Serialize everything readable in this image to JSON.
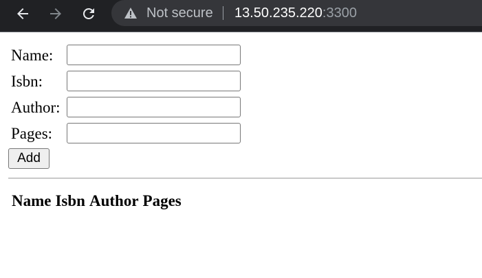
{
  "browser": {
    "security_text": "Not secure",
    "url_host": "13.50.235.220",
    "url_port": ":3300"
  },
  "form": {
    "fields": [
      {
        "label": "Name:",
        "value": ""
      },
      {
        "label": "Isbn:",
        "value": ""
      },
      {
        "label": "Author:",
        "value": ""
      },
      {
        "label": "Pages:",
        "value": ""
      }
    ],
    "add_label": "Add"
  },
  "table": {
    "headers": [
      "Name",
      "Isbn",
      "Author",
      "Pages"
    ]
  },
  "colors": {
    "toolbar_bg": "#202124",
    "omnibox_bg": "#35363a"
  }
}
